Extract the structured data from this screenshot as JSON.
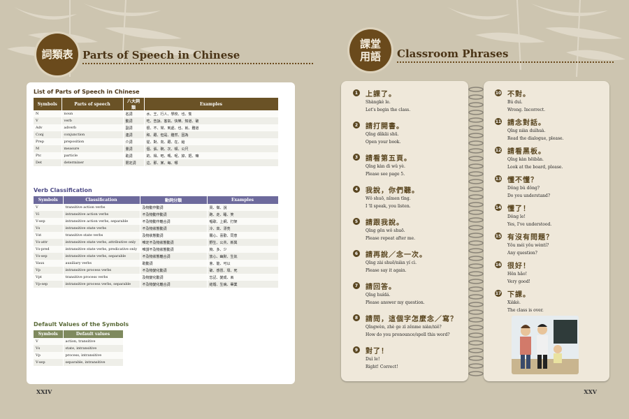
{
  "left_page": {
    "header": {
      "badge": "詞類表",
      "title": "Parts of Speech in Chinese"
    },
    "section1": {
      "title": "List of Parts of Speech in Chinese",
      "headers": [
        "Symbols",
        "Parts of speech",
        "八大詞類",
        "Examples"
      ],
      "rows": [
        [
          "N",
          "noun",
          "名詞",
          "水、王、行人、學校、也、隻"
        ],
        [
          "V",
          "verb",
          "動詞",
          "吃、告訴、客氣、快樂、知道、破"
        ],
        [
          "Adv",
          "adverb",
          "副詞",
          "很、不、常、到處、也、就、難道"
        ],
        [
          "Conj",
          "conjunction",
          "連詞",
          "和、跟、但是、雖然、因為"
        ],
        [
          "Prep",
          "preposition",
          "介詞",
          "從、對、向、跟、在、給"
        ],
        [
          "M",
          "measure",
          "量詞",
          "個、張、碗、次、頓、公尺"
        ],
        [
          "Ptc",
          "particle",
          "助詞",
          "的、得、吧、嗎、呢、掉、把、嘛"
        ],
        [
          "Det",
          "determiner",
          "限定詞",
          "這、那、某、每、哪"
        ]
      ]
    },
    "section2": {
      "title": "Verb Classification",
      "headers": [
        "Symbols",
        "Classification",
        "動詞分類",
        "Examples"
      ],
      "rows": [
        [
          "V",
          "transitive action verbs",
          "及物動作動詞",
          "買、做、說"
        ],
        [
          "Vi",
          "intransitive action verbs",
          "不及物動作動詞",
          "跑、走、睡、笑"
        ],
        [
          "V-sep",
          "intransitive action verbs, separable",
          "不及物動作離合詞",
          "唱歌、上網、打架"
        ],
        [
          "Vs",
          "intransitive state verbs",
          "不及物狀態動詞",
          "冷、高、漂亮"
        ],
        [
          "Vst",
          "transitive state verbs",
          "及物狀態動詞",
          "關心、喜歡、同意"
        ],
        [
          "Vs-attr",
          "intransitive state verbs, attributive only",
          "唯定不及物狀態動詞",
          "野生、公共、新興"
        ],
        [
          "Vs-pred",
          "intransitive state verbs, predicative only",
          "唯謂不及物狀態動詞",
          "夠、多、少"
        ],
        [
          "Vs-sep",
          "intransitive state verbs, separable",
          "不及物狀態離合詞",
          "放心、幽默、生氣"
        ],
        [
          "Vaux",
          "auxiliary verbs",
          "助動詞",
          "會、能、可以"
        ],
        [
          "Vp",
          "intransitive process verbs",
          "不及物變化動詞",
          "破、感冒、壞、死"
        ],
        [
          "Vpt",
          "transitive process verbs",
          "及物變化動詞",
          "忘記、變成、丟"
        ],
        [
          "Vp-sep",
          "intransitive process verbs, separable",
          "不及物變化離合詞",
          "結婚、生病、畢業"
        ]
      ]
    },
    "section3": {
      "title": "Default Values of the Symbols",
      "headers": [
        "Symbols",
        "Default values"
      ],
      "rows": [
        [
          "V",
          "action, transitive"
        ],
        [
          "Vs",
          "state, intransitive"
        ],
        [
          "Vp",
          "process, intransitive"
        ],
        [
          "V-sep",
          "separable, intransitive"
        ]
      ]
    },
    "page_number": "XXIV"
  },
  "right_page": {
    "header": {
      "badge_line1": "課堂",
      "badge_line2": "用語",
      "title": "Classroom Phrases"
    },
    "phrases_left": [
      {
        "num": "1",
        "zh": "上課了。",
        "py": "Shàngkè le.",
        "en": "Let's begin the class."
      },
      {
        "num": "2",
        "zh": "請打開書。",
        "py": "Qǐng dǎkāi shū.",
        "en": "Open your book."
      },
      {
        "num": "3",
        "zh": "請看第五頁。",
        "py": "Qǐng kàn dì wǔ yè.",
        "en": "Please see page 5."
      },
      {
        "num": "4",
        "zh": "我說，你們聽。",
        "py": "Wǒ shuō, nǐmen tīng.",
        "en": "I 'll speak, you listen."
      },
      {
        "num": "5",
        "zh": "請跟我說。",
        "py": "Qǐng gēn wǒ shuō.",
        "en": "Please repeat after me."
      },
      {
        "num": "6",
        "zh": "請再說／念一次。",
        "py": "Qǐng zài shuō/niàn yí cì.",
        "en": "Please say it again."
      },
      {
        "num": "7",
        "zh": "請回答。",
        "py": "Qǐng huídá.",
        "en": "Please answer my question."
      },
      {
        "num": "8",
        "zh": "請問，這個字怎麼念／寫？",
        "py": "Qǐngwèn, zhè ge zì zěnme niàn/xiě?",
        "en": "How do you pronounce/spell this word?"
      },
      {
        "num": "9",
        "zh": "對了！",
        "py": "Duì le!",
        "en": "Right! Correct!"
      }
    ],
    "phrases_right": [
      {
        "num": "10",
        "zh": "不對。",
        "py": "Bú duì.",
        "en": "Wrong. Incorrect."
      },
      {
        "num": "11",
        "zh": "請念對話。",
        "py": "Qǐng niàn duìhuà.",
        "en": "Read the dialogue, please."
      },
      {
        "num": "12",
        "zh": "請看黑板。",
        "py": "Qǐng kàn hēibǎn.",
        "en": "Look at the board, please."
      },
      {
        "num": "13",
        "zh": "懂不懂？",
        "py": "Dǒng bù dǒng?",
        "en": "Do you understand?"
      },
      {
        "num": "14",
        "zh": "懂了！",
        "py": "Dǒng le!",
        "en": "Yes, I've understood."
      },
      {
        "num": "15",
        "zh": "有沒有問題？",
        "py": "Yǒu méi yǒu wèntí?",
        "en": "Any question?"
      },
      {
        "num": "16",
        "zh": "很好！",
        "py": "Hěn hǎo!",
        "en": "Very good!"
      },
      {
        "num": "17",
        "zh": "下課。",
        "py": "Xiàkè.",
        "en": "The class is over."
      }
    ],
    "page_number": "XXV"
  },
  "colors": {
    "brand_brown": "#6a4a1c",
    "table1_header": "#6a5226",
    "table2_header": "#6d6a9c",
    "table3_header": "#7f8a5e"
  }
}
